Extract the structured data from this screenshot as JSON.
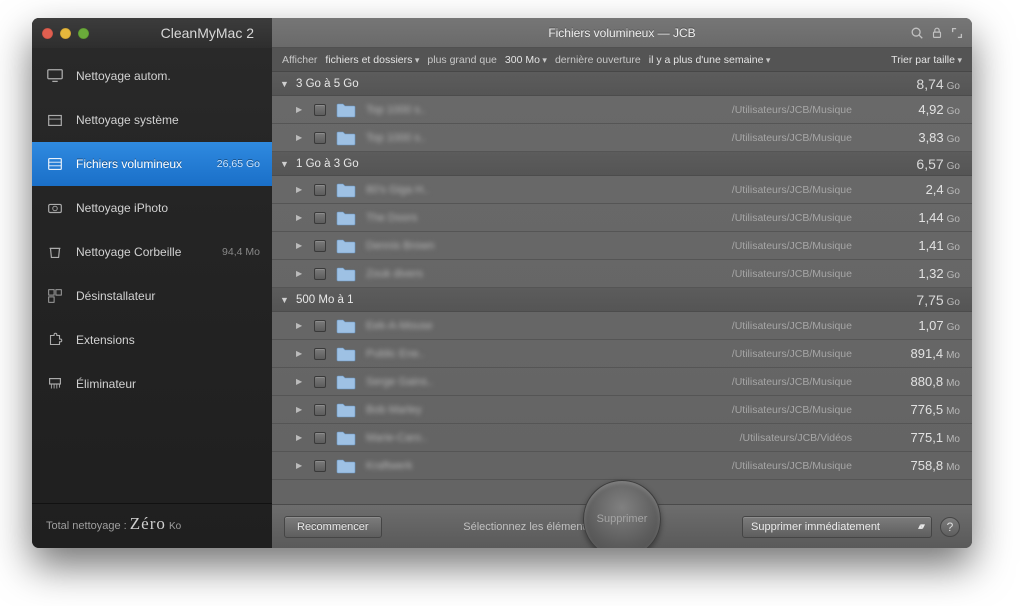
{
  "app": {
    "title": "CleanMyMac 2"
  },
  "sidebar": {
    "items": [
      {
        "label": "Nettoyage autom.",
        "icon": "monitor",
        "value": ""
      },
      {
        "label": "Nettoyage système",
        "icon": "box",
        "value": ""
      },
      {
        "label": "Fichiers volumineux",
        "icon": "drawer",
        "value": "26,65 Go",
        "selected": true
      },
      {
        "label": "Nettoyage iPhoto",
        "icon": "camera",
        "value": ""
      },
      {
        "label": "Nettoyage Corbeille",
        "icon": "trash",
        "value": "94,4 Mo"
      },
      {
        "label": "Désinstallateur",
        "icon": "apps",
        "value": ""
      },
      {
        "label": "Extensions",
        "icon": "puzzle",
        "value": ""
      },
      {
        "label": "Éliminateur",
        "icon": "shredder",
        "value": ""
      }
    ],
    "footer": {
      "label": "Total nettoyage :",
      "value": "Zéro",
      "unit": "Ko"
    }
  },
  "header": {
    "title": "Fichiers volumineux — JCB"
  },
  "filter": {
    "show_label": "Afficher",
    "type": "fichiers et dossiers",
    "gt_label": "plus grand que",
    "size": "300 Mo",
    "last_open_label": "dernière ouverture",
    "when": "il y a plus d'une semaine",
    "sort": "Trier par taille"
  },
  "groups": [
    {
      "label": "3 Go à 5 Go",
      "size": "8,74",
      "unit": "Go",
      "rows": [
        {
          "name": "Top 1000 s..",
          "path": "/Utilisateurs/JCB/Musique",
          "size": "4,92",
          "unit": "Go"
        },
        {
          "name": "Top 1000 s..",
          "path": "/Utilisateurs/JCB/Musique",
          "size": "3,83",
          "unit": "Go"
        }
      ]
    },
    {
      "label": "1 Go à 3 Go",
      "size": "6,57",
      "unit": "Go",
      "rows": [
        {
          "name": "80's Giga H..",
          "path": "/Utilisateurs/JCB/Musique",
          "size": "2,4",
          "unit": "Go"
        },
        {
          "name": "The Doors",
          "path": "/Utilisateurs/JCB/Musique",
          "size": "1,44",
          "unit": "Go"
        },
        {
          "name": "Dennis Brown",
          "path": "/Utilisateurs/JCB/Musique",
          "size": "1,41",
          "unit": "Go"
        },
        {
          "name": "Zouk divers",
          "path": "/Utilisateurs/JCB/Musique",
          "size": "1,32",
          "unit": "Go"
        }
      ]
    },
    {
      "label": "500 Mo à 1",
      "size": "7,75",
      "unit": "Go",
      "rows": [
        {
          "name": "Eek-A-Mouse",
          "path": "/Utilisateurs/JCB/Musique",
          "size": "1,07",
          "unit": "Go"
        },
        {
          "name": "Public Ene..",
          "path": "/Utilisateurs/JCB/Musique",
          "size": "891,4",
          "unit": "Mo"
        },
        {
          "name": "Serge Gains..",
          "path": "/Utilisateurs/JCB/Musique",
          "size": "880,8",
          "unit": "Mo"
        },
        {
          "name": "Bob Marley",
          "path": "/Utilisateurs/JCB/Musique",
          "size": "776,5",
          "unit": "Mo"
        },
        {
          "name": "Marie-Caro..",
          "path": "/Utilisateurs/JCB/Vidéos",
          "size": "775,1",
          "unit": "Mo"
        },
        {
          "name": "Kraftwerk",
          "path": "/Utilisateurs/JCB/Musique",
          "size": "758,8",
          "unit": "Mo"
        }
      ]
    }
  ],
  "bottom": {
    "restart": "Recommencer",
    "hint": "Sélectionnez les éléments à",
    "delete": "Supprimer",
    "mode": "Supprimer immédiatement"
  }
}
